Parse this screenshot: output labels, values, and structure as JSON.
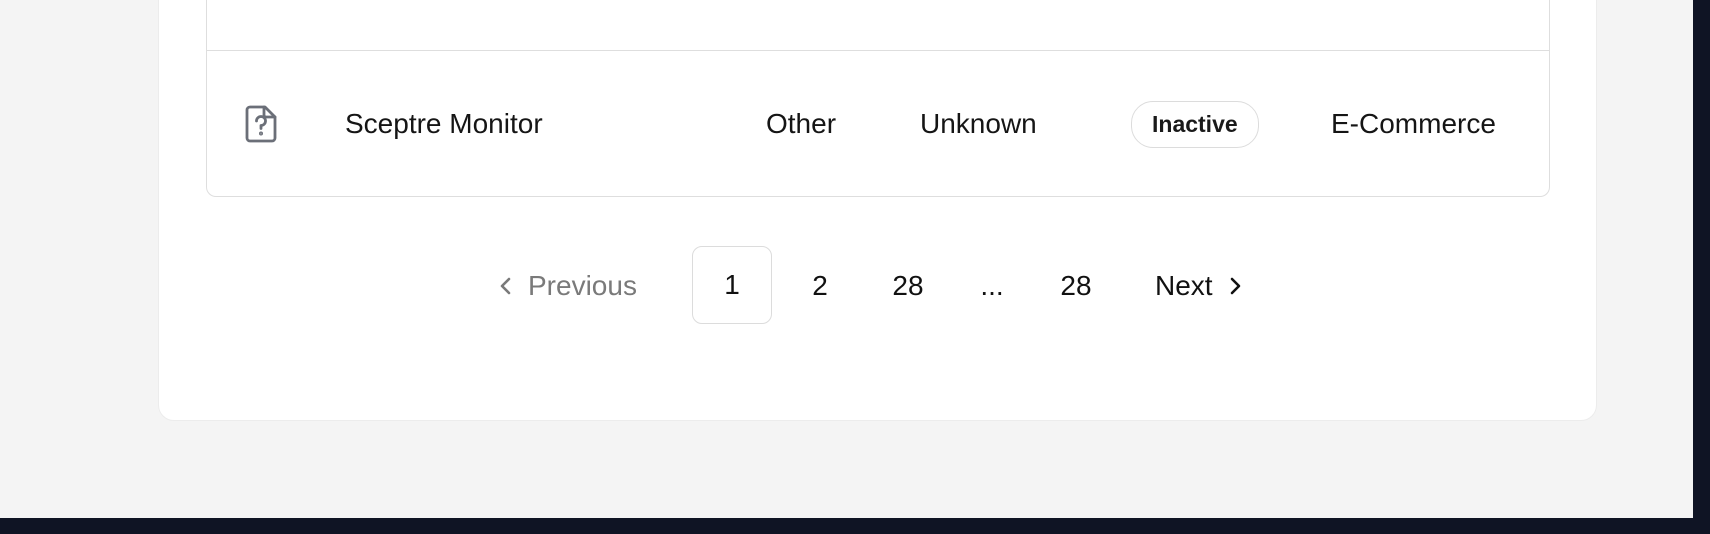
{
  "table": {
    "rows": [
      {
        "icon": "file-question-icon",
        "name": "Sceptre Monitor",
        "type": "Other",
        "warranty": "Unknown",
        "status": "Inactive",
        "department": "E-Commerce"
      }
    ]
  },
  "pagination": {
    "previous_label": "Previous",
    "next_label": "Next",
    "pages": [
      "1",
      "2",
      "28",
      "...",
      "28"
    ],
    "current_page": "1"
  },
  "colors": {
    "page_background": "#f4f4f4",
    "card_background": "#ffffff",
    "border": "#dedede",
    "muted_text": "#7a7a7a",
    "frame": "#0f1424"
  }
}
